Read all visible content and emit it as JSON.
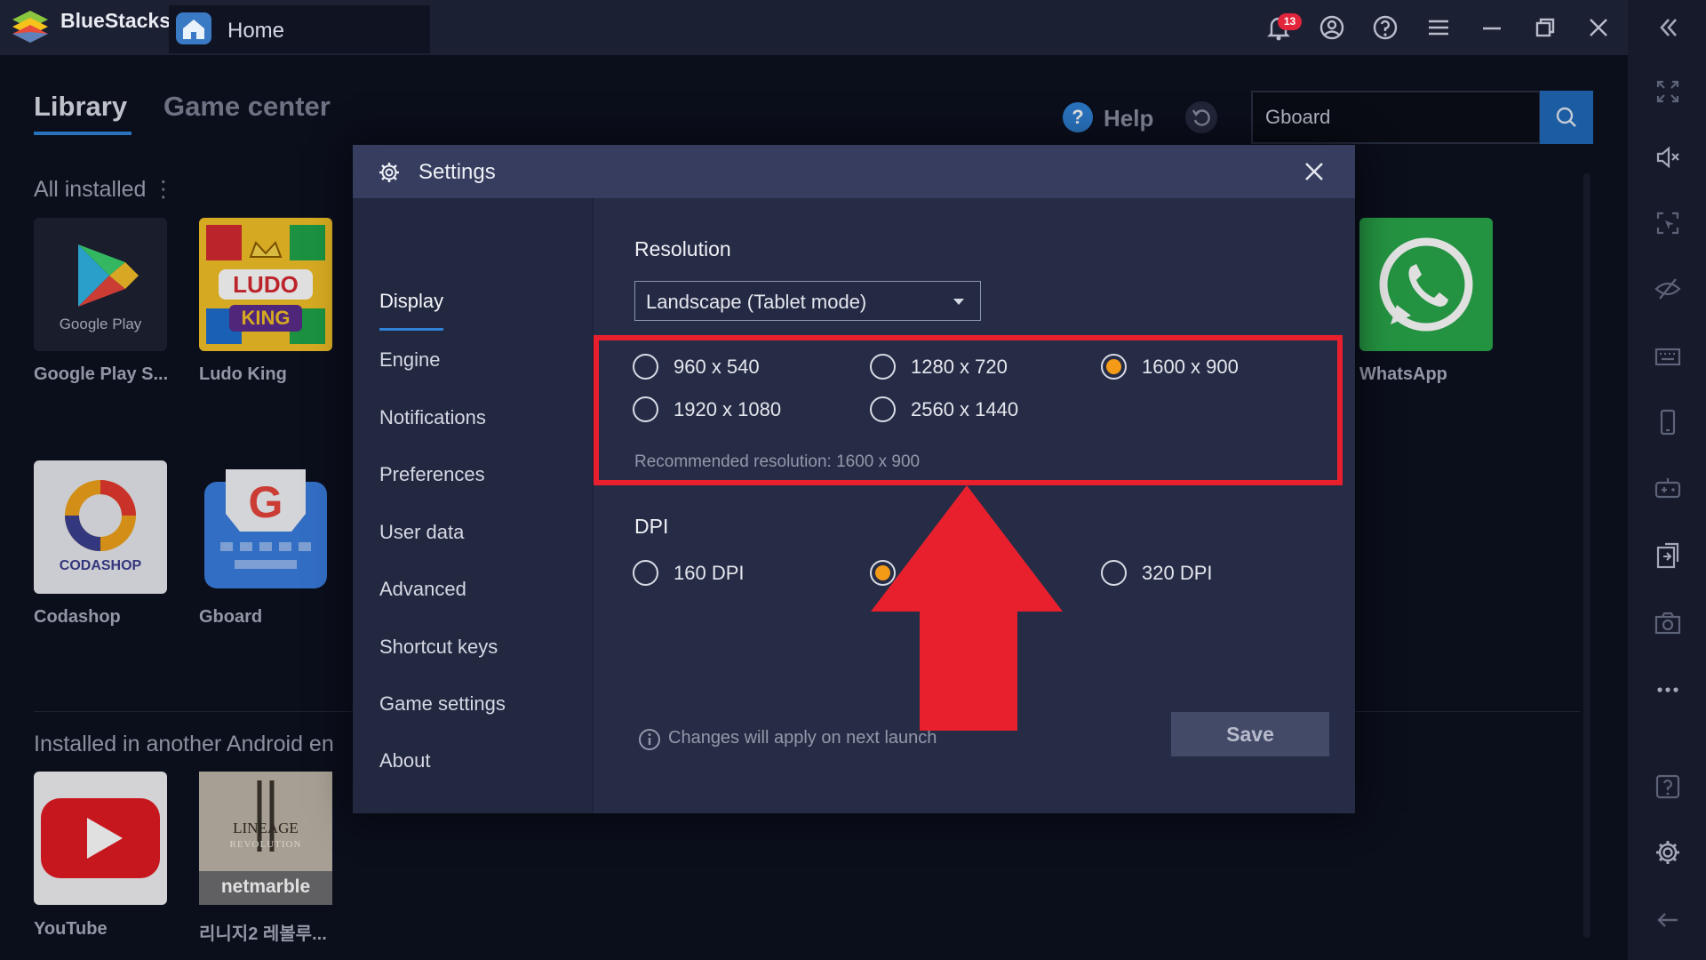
{
  "window": {
    "brand": "BlueStacks",
    "tab_label": "Home",
    "notification_count": "13"
  },
  "library": {
    "tabs": [
      "Library",
      "Game center"
    ],
    "help_label": "Help",
    "search_value": "Gboard",
    "section_installed": "All installed",
    "section_other": "Installed in another Android en",
    "apps": [
      {
        "name": "Google Play S...",
        "icon": "google-play-icon"
      },
      {
        "name": "Ludo King",
        "icon": "ludo-king-icon"
      },
      {
        "name": "WhatsApp",
        "icon": "whatsapp-icon"
      },
      {
        "name": "Codashop",
        "icon": "codashop-icon"
      },
      {
        "name": "Gboard",
        "icon": "gboard-icon"
      },
      {
        "name": "YouTube",
        "icon": "youtube-icon"
      },
      {
        "name": "리니지2 레볼루...",
        "icon": "lineage-revolution-icon"
      }
    ],
    "tile_text": {
      "google_play": "Google Play",
      "codashop": "CODASHOP",
      "lineage": "LINEAGE",
      "revolution": "REVOLUTION",
      "netmarble": "netmarble"
    }
  },
  "settings": {
    "title": "Settings",
    "nav": [
      "Display",
      "Engine",
      "Notifications",
      "Preferences",
      "User data",
      "Advanced",
      "Shortcut keys",
      "Game settings",
      "About"
    ],
    "active_nav": "Display",
    "resolution_heading": "Resolution",
    "orientation_value": "Landscape (Tablet mode)",
    "resolutions": [
      "960 x 540",
      "1280 x 720",
      "1600 x 900",
      "1920 x 1080",
      "2560 x 1440"
    ],
    "selected_resolution": "1600 x 900",
    "recommended": "Recommended resolution: 1600 x 900",
    "dpi_heading": "DPI",
    "dpi_options": [
      "160 DPI",
      "320 DPI"
    ],
    "info_text": "Changes will apply on next launch",
    "save_label": "Save"
  },
  "colors": {
    "accent_blue": "#2f82d6",
    "radio_selected": "#f39b17",
    "annotation_red": "#e8202e"
  }
}
